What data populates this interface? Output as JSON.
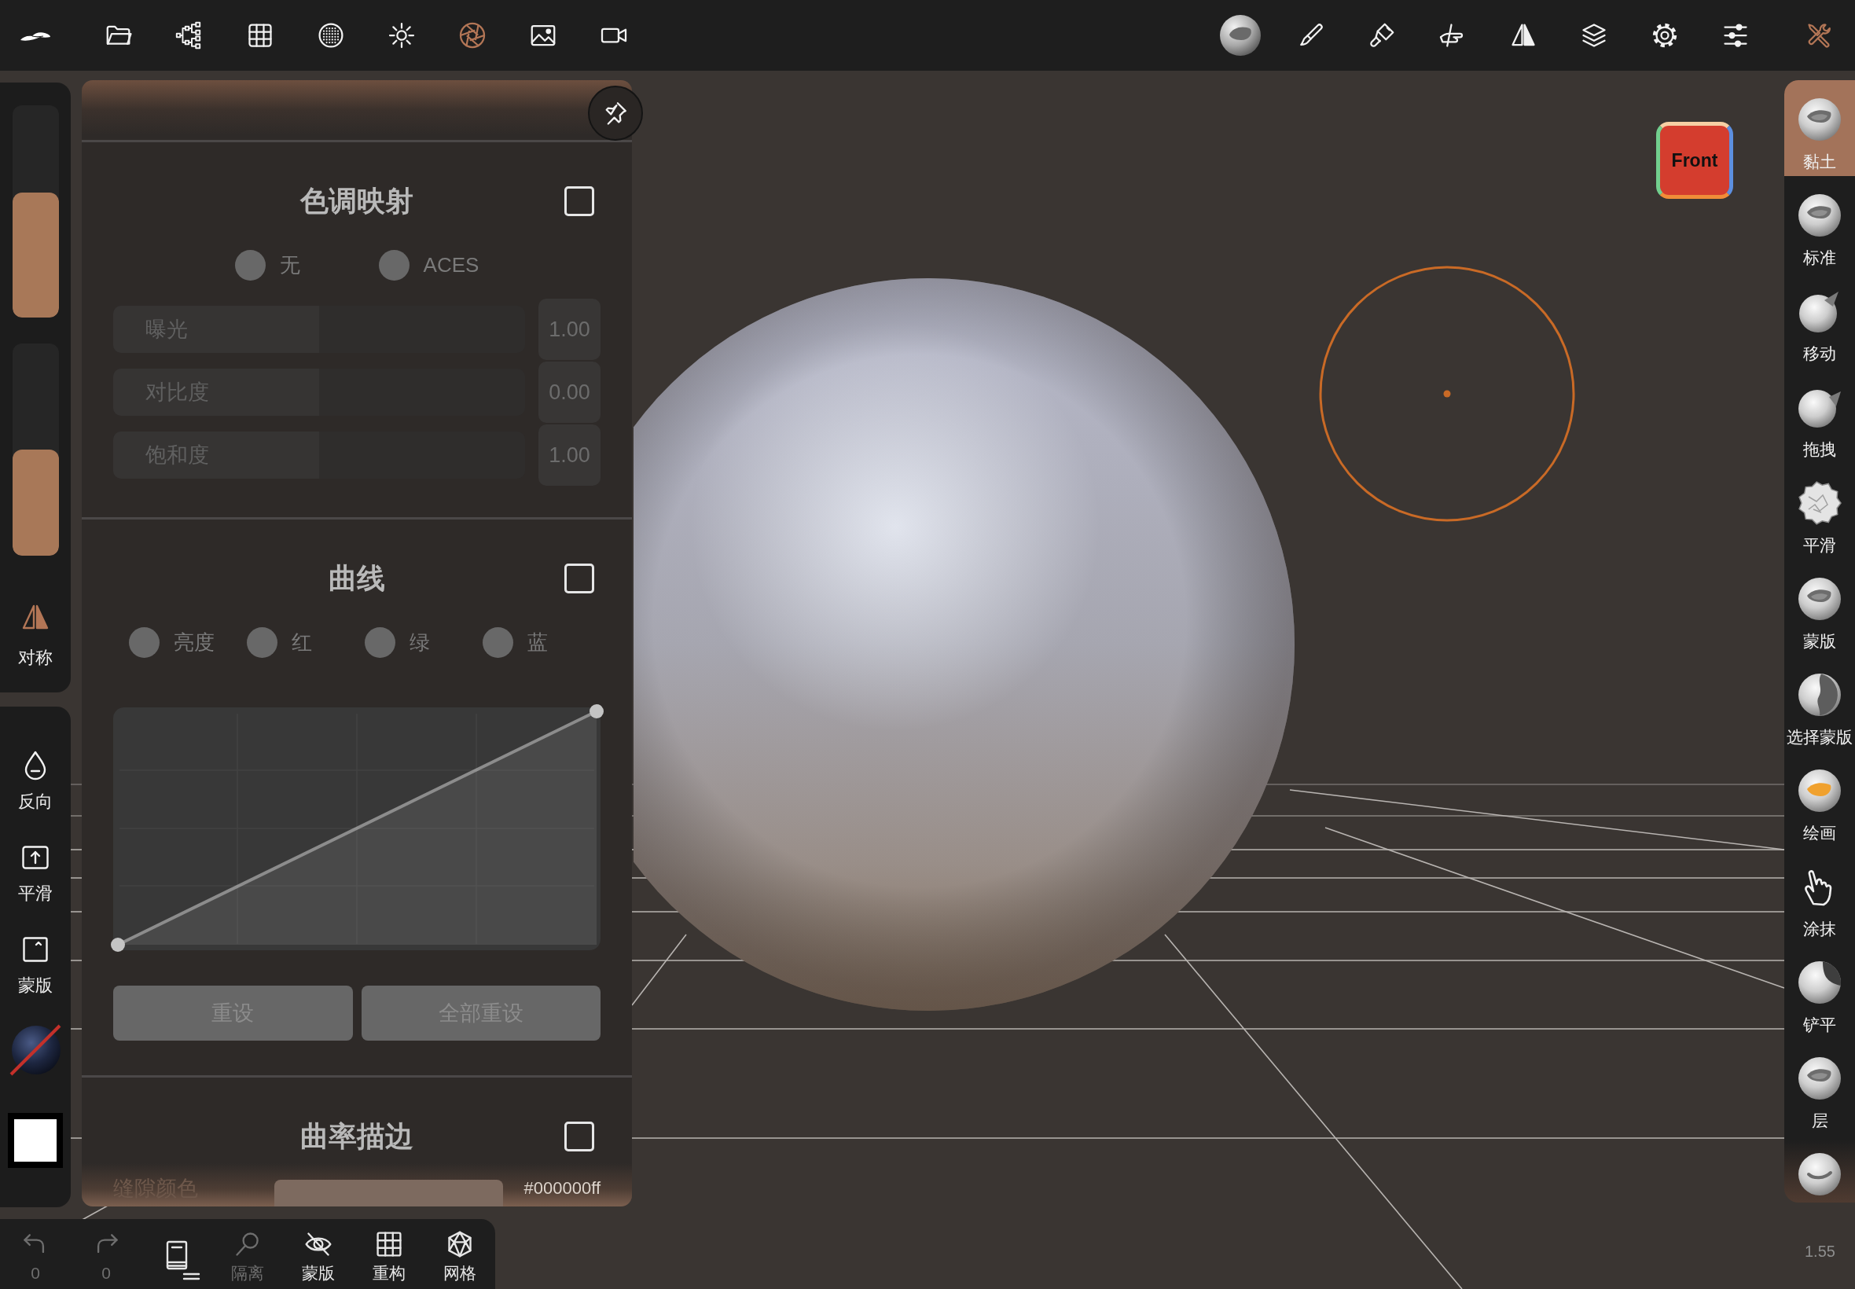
{
  "top_bar": {
    "menu_buttons": [
      {
        "selected": false
      },
      {
        "selected": false
      },
      {
        "selected": false
      },
      {
        "selected": false
      },
      {
        "selected": false
      },
      {
        "selected": true
      },
      {
        "selected": false
      },
      {
        "selected": false
      }
    ],
    "tool_buttons": [
      {
        "selected": false
      },
      {
        "selected": false
      },
      {
        "selected": false
      },
      {
        "selected": false
      },
      {
        "selected": false
      },
      {
        "selected": false
      },
      {
        "selected": false
      },
      {
        "selected": false
      },
      {
        "selected": true
      }
    ]
  },
  "left_sidebar": {
    "sliders": [
      {
        "level": 0.59
      },
      {
        "level": 0.5
      }
    ],
    "symmetry": {
      "label": "对称",
      "on": true
    },
    "tools": [
      {
        "label": "反向"
      },
      {
        "label": "平滑"
      },
      {
        "label": "蒙版"
      }
    ]
  },
  "panel": {
    "sections": [
      {
        "kind": "tone_mapping",
        "title": "色调映射",
        "checked": false,
        "options": [
          {
            "label": "无",
            "selected": false
          },
          {
            "label": "ACES",
            "selected": false
          }
        ],
        "sliders": [
          {
            "label": "曝光",
            "value": "1.00",
            "level": 0.5
          },
          {
            "label": "对比度",
            "value": "0.00",
            "level": 0.5
          },
          {
            "label": "饱和度",
            "value": "1.00",
            "level": 0.5
          }
        ]
      },
      {
        "kind": "curves",
        "title": "曲线",
        "checked": false,
        "options": [
          {
            "label": "亮度",
            "selected": false
          },
          {
            "label": "红",
            "selected": false
          },
          {
            "label": "绿",
            "selected": false
          },
          {
            "label": "蓝",
            "selected": false
          }
        ],
        "buttons": [
          {
            "label": "重设",
            "disabled": true
          },
          {
            "label": "全部重设",
            "disabled": true
          }
        ]
      },
      {
        "kind": "curvature",
        "title": "曲率描边",
        "checked": false,
        "color_rows": [
          {
            "label": "缝隙颜色",
            "value": "#000000ff"
          }
        ]
      }
    ]
  },
  "bottom_bar": {
    "items": [
      {
        "label": "0",
        "disabled": true
      },
      {
        "label": "0",
        "disabled": true
      },
      {
        "disabled": false
      },
      {
        "label": "隔离",
        "disabled": true
      },
      {
        "label": "蒙版",
        "disabled": false
      },
      {
        "label": "重构",
        "disabled": false
      },
      {
        "label": "网格",
        "disabled": false
      }
    ]
  },
  "right_toolbar": {
    "tools": [
      {
        "label": "黏土",
        "selected": true
      },
      {
        "label": "标准",
        "selected": false
      },
      {
        "label": "移动",
        "selected": false
      },
      {
        "label": "拖拽",
        "selected": false
      },
      {
        "label": "平滑",
        "selected": false
      },
      {
        "label": "蒙版",
        "selected": false
      },
      {
        "label": "选择蒙版",
        "selected": false
      },
      {
        "label": "绘画",
        "selected": false
      },
      {
        "label": "涂抹",
        "selected": false
      },
      {
        "label": "铲平",
        "selected": false
      },
      {
        "label": "层",
        "selected": false
      },
      {
        "selected": false
      }
    ]
  },
  "viewport": {
    "view_cube": {
      "label": "Front"
    },
    "corner_value": "1.55"
  }
}
